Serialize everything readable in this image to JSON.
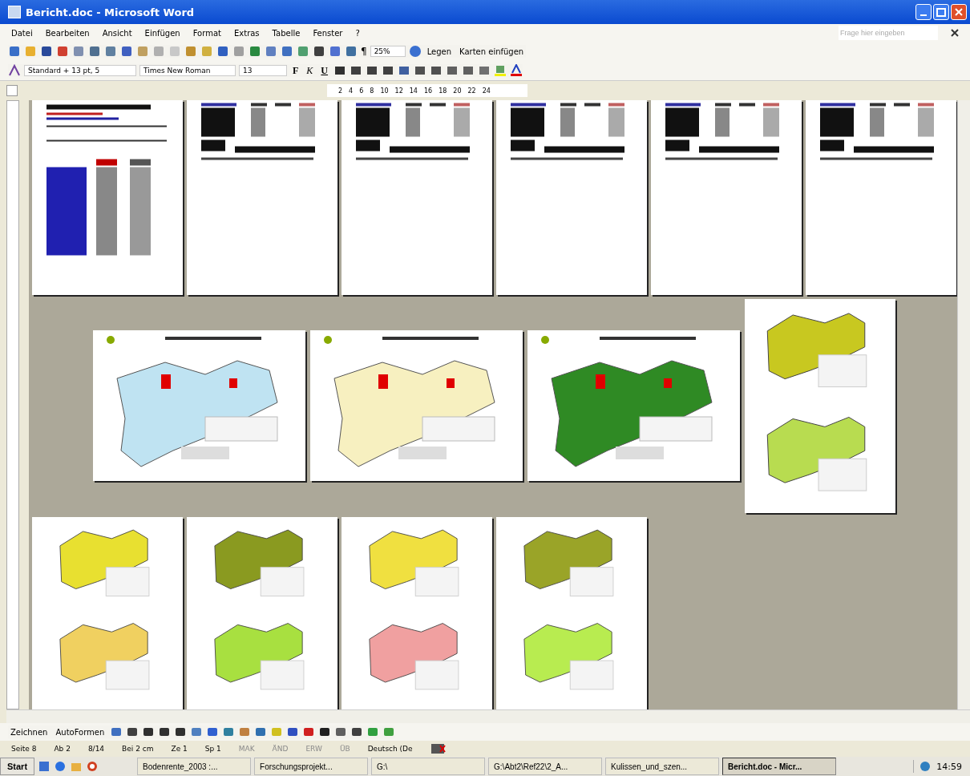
{
  "window": {
    "title": "Bericht.doc - Microsoft Word"
  },
  "menu": [
    "Datei",
    "Bearbeiten",
    "Ansicht",
    "Einfügen",
    "Format",
    "Extras",
    "Tabelle",
    "Fenster",
    "?"
  ],
  "help": {
    "placeholder": "Frage hier eingeben"
  },
  "standard_toolbar": {
    "pilcrow": "¶",
    "zoom": "25%",
    "legen": "Legen",
    "karten": "Karten einfügen"
  },
  "format_toolbar": {
    "style": "Standard + 13 pt, 5",
    "font": "Times New Roman",
    "size": "13",
    "bold": "F",
    "italic": "K",
    "underline": "U"
  },
  "ruler": [
    "2",
    "4",
    "6",
    "8",
    "10",
    "12",
    "14",
    "16",
    "18",
    "20",
    "22",
    "24"
  ],
  "pages": [
    {
      "kind": "cover"
    },
    {
      "kind": "table"
    },
    {
      "kind": "table"
    },
    {
      "kind": "table"
    },
    {
      "kind": "table"
    },
    {
      "kind": "table"
    },
    {
      "kind": "map",
      "color": "#bfe3f2"
    },
    {
      "kind": "map",
      "color": "#f7f0c0"
    },
    {
      "kind": "map",
      "color": "#2f8a24"
    },
    {
      "kind": "double-map",
      "maps": [
        {
          "color": "#c8c820"
        },
        {
          "color": "#b8dc50"
        }
      ]
    },
    {
      "kind": "double-map",
      "maps": [
        {
          "color": "#e8e030"
        },
        {
          "color": "#f0d060"
        }
      ]
    },
    {
      "kind": "double-map",
      "maps": [
        {
          "color": "#8a9a20"
        },
        {
          "color": "#a8e040"
        }
      ]
    },
    {
      "kind": "double-map",
      "maps": [
        {
          "color": "#f0e040"
        },
        {
          "color": "#f0a0a0"
        }
      ]
    },
    {
      "kind": "double-map",
      "maps": [
        {
          "color": "#9aa428"
        },
        {
          "color": "#b8ec50"
        }
      ]
    }
  ],
  "drawing_toolbar": {
    "draw": "Zeichnen",
    "autoshapes": "AutoFormen"
  },
  "status_bar": [
    {
      "text": "Seite 8",
      "disabled": false
    },
    {
      "text": "Ab 2",
      "disabled": false
    },
    {
      "text": "8/14",
      "disabled": false
    },
    {
      "text": "Bei 2 cm",
      "disabled": false
    },
    {
      "text": "Ze 1",
      "disabled": false
    },
    {
      "text": "Sp 1",
      "disabled": false
    },
    {
      "text": "MAK",
      "disabled": true
    },
    {
      "text": "ÄND",
      "disabled": true
    },
    {
      "text": "ERW",
      "disabled": true
    },
    {
      "text": "ÜB",
      "disabled": true
    },
    {
      "text": "Deutsch (De",
      "disabled": false
    }
  ],
  "taskbar": {
    "start": "Start",
    "items": [
      {
        "label": "Bodenrente_2003 :...",
        "selected": false
      },
      {
        "label": "Forschungsprojekt...",
        "selected": false
      },
      {
        "label": "G:\\",
        "selected": false
      },
      {
        "label": "G:\\Abt2\\Ref22\\2_A...",
        "selected": false
      },
      {
        "label": "Kulissen_und_szen...",
        "selected": false
      },
      {
        "label": "Bericht.doc - Micr...",
        "selected": true
      }
    ],
    "clock": "14:59"
  }
}
